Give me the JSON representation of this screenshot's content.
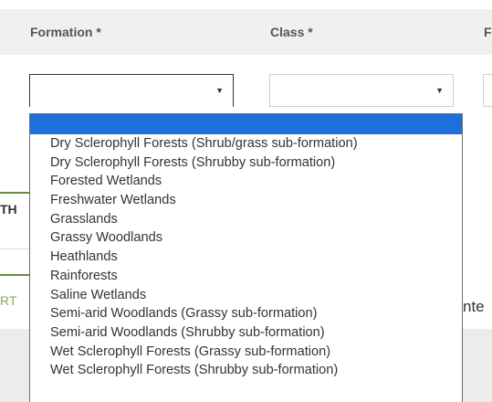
{
  "form": {
    "columns": [
      {
        "label": "Formation *"
      },
      {
        "label": "Class *"
      },
      {
        "label": "F"
      }
    ],
    "formation_select": {
      "value": ""
    },
    "class_select": {
      "value": ""
    }
  },
  "background_text": {
    "tab_fragment": "TH",
    "row_fragment": "RT",
    "right_fragment": "nte"
  },
  "dropdown": {
    "options": [
      "",
      "Dry Sclerophyll Forests (Shrub/grass sub-formation)",
      "Dry Sclerophyll Forests (Shrubby sub-formation)",
      "Forested Wetlands",
      "Freshwater Wetlands",
      "Grasslands",
      "Grassy Woodlands",
      "Heathlands",
      "Rainforests",
      "Saline Wetlands",
      "Semi-arid Woodlands (Grassy sub-formation)",
      "Semi-arid Woodlands (Shrubby sub-formation)",
      "Wet Sclerophyll Forests (Grassy sub-formation)",
      "Wet Sclerophyll Forests (Shrubby sub-formation)"
    ],
    "highlighted_index": 0
  },
  "colors": {
    "highlight": "#1e6fdc",
    "accent_green": "#6a8f3a",
    "header_bg": "#f0f0f0"
  },
  "icons": {
    "select_caret": "chevron-down-icon"
  }
}
